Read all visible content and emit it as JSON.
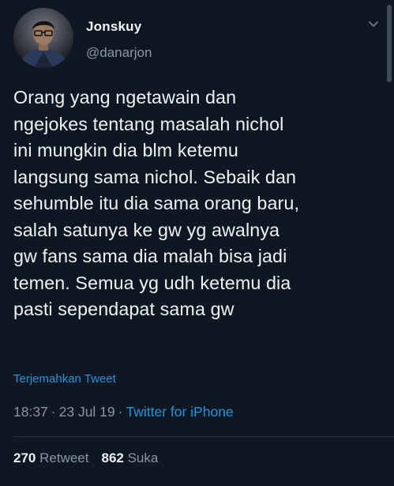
{
  "tweet": {
    "author_name": "Jonskuy",
    "author_handle": "@danarjon",
    "text": "Orang yang ngetawain dan\nngejokes tentang masalah nichol\nini mungkin dia blm ketemu\nlangsung sama nichol. Sebaik dan\nsehumble itu dia sama orang baru,\nsalah satunya ke gw yg awalnya\ngw fans sama dia malah bisa jadi\ntemen. Semua yg udh ketemu dia\npasti sependapat sama gw",
    "translate_label": "Terjemahkan Tweet",
    "time": "18:37",
    "separator": "·",
    "date": "23 Jul 19",
    "source": "Twitter for iPhone",
    "retweet_count": "270",
    "retweet_label": "Retweet",
    "like_count": "862",
    "like_label": "Suka"
  },
  "icons": {
    "avatar": "avatar-photo",
    "menu": "chevron-down-icon"
  },
  "colors": {
    "background": "#0f1822",
    "accent": "#1b95e0",
    "secondary_text": "#8796a5",
    "primary_text": "#eef2f6"
  }
}
